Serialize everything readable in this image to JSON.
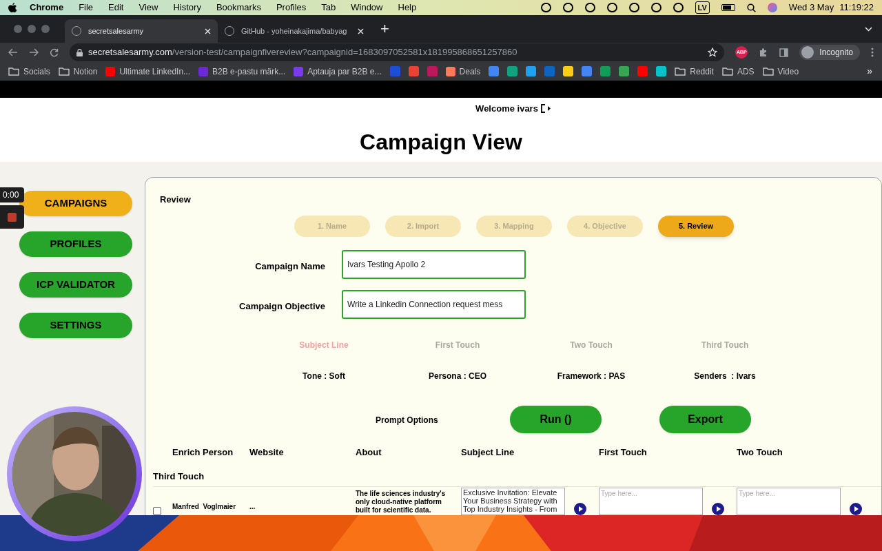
{
  "menu_bar": {
    "app": "Chrome",
    "menus": [
      "File",
      "Edit",
      "View",
      "History",
      "Bookmarks",
      "Profiles",
      "Tab",
      "Window",
      "Help"
    ],
    "keyboard": "LV",
    "date": "Wed 3 May",
    "time": "11:19:22"
  },
  "browser": {
    "tabs": [
      {
        "title": "secretsalesarmy",
        "selected": true
      },
      {
        "title": "GitHub - yoheinakajima/babyag",
        "selected": false
      }
    ],
    "new_tab": "+",
    "url_host": "secretsalesarmy.com",
    "url_path": "/version-test/campaignfivereview?campaignid=1683097052581x181995868651257860",
    "extension": "ABP",
    "profile": "Incognito",
    "bookmarks": [
      {
        "kind": "folder",
        "label": "Socials"
      },
      {
        "kind": "folder",
        "label": "Notion"
      },
      {
        "kind": "site",
        "label": "Ultimate LinkedIn...",
        "color": "#ff0000"
      },
      {
        "kind": "site",
        "label": "B2B e-pastu märk...",
        "color": "#6d28d9"
      },
      {
        "kind": "site",
        "label": "Aptauja par B2B e...",
        "color": "#7c3aed"
      },
      {
        "kind": "icon",
        "color": "#1d4ed8"
      },
      {
        "kind": "icon",
        "color": "#ea4335"
      },
      {
        "kind": "icon",
        "color": "#be185d"
      },
      {
        "kind": "site",
        "label": "Deals",
        "color": "#ff7a59"
      },
      {
        "kind": "icon",
        "color": "#4285f4"
      },
      {
        "kind": "icon",
        "color": "#10a37f"
      },
      {
        "kind": "icon",
        "color": "#1da1f2"
      },
      {
        "kind": "icon",
        "color": "#0a66c2"
      },
      {
        "kind": "icon",
        "color": "#facc15"
      },
      {
        "kind": "icon",
        "color": "#4285f4"
      },
      {
        "kind": "icon",
        "color": "#0f9d58"
      },
      {
        "kind": "icon",
        "color": "#34a853"
      },
      {
        "kind": "icon",
        "color": "#ff0000"
      },
      {
        "kind": "icon",
        "color": "#00c4cc"
      },
      {
        "kind": "folder",
        "label": "Reddit"
      },
      {
        "kind": "folder",
        "label": "ADS"
      },
      {
        "kind": "folder",
        "label": "Video"
      }
    ],
    "more": "»"
  },
  "recorder": {
    "time": "0:00"
  },
  "page": {
    "welcome": "Welcome ivars",
    "title": "Campaign View",
    "sidebar": [
      {
        "label": "CAMPAIGNS",
        "selected": true
      },
      {
        "label": "PROFILES",
        "selected": false
      },
      {
        "label": "ICP VALIDATOR",
        "selected": false
      },
      {
        "label": "SETTINGS",
        "selected": false
      }
    ],
    "section": "Review",
    "steps": [
      {
        "label": "1. Name",
        "selected": false
      },
      {
        "label": "2. Import",
        "selected": false
      },
      {
        "label": "3. Mapping",
        "selected": false
      },
      {
        "label": "4. Objective",
        "selected": false
      },
      {
        "label": "5. Review",
        "selected": true
      }
    ],
    "fields": [
      {
        "label": "Campaign Name",
        "value": "Ivars Testing Apollo 2"
      },
      {
        "label": "Campaign Objective",
        "value": "Write a Linkedin Connection request mess"
      }
    ],
    "message_tabs": [
      {
        "label": "Subject Line",
        "selected": true
      },
      {
        "label": "First Touch",
        "selected": false
      },
      {
        "label": "Two Touch",
        "selected": false
      },
      {
        "label": "Third Touch",
        "selected": false
      }
    ],
    "settings": [
      "Tone : Soft",
      "Persona : CEO",
      "Framework : PAS",
      "Senders  : Ivars"
    ],
    "prompt_options": "Prompt Options",
    "run_button": "Run ()",
    "export_button": "Export",
    "table": {
      "columns": [
        "Enrich Person",
        "Website",
        "About",
        "Subject Line",
        "First Touch",
        "Two Touch"
      ],
      "extra_column": "Third Touch",
      "rows": [
        {
          "checked": false,
          "name": "Manfred  Voglmaier",
          "website": "...",
          "about": "The life sciences industry's only cloud-native platform built for scientific data.",
          "subject_line": "Exclusive Invitation: Elevate Your Business Strategy with Top Industry Insights - From",
          "first_touch_placeholder": "Type here...",
          "two_touch_placeholder": "Type here..."
        }
      ]
    }
  }
}
